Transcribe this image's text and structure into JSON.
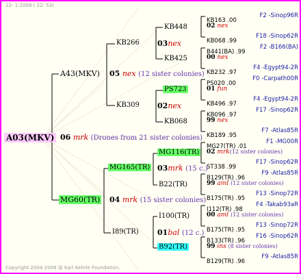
{
  "header": {
    "date_label": "12-  1-2008 ( 22: 53)"
  },
  "footer": {
    "copyright": "Copyright 2004-2008 @ Karl Kehrle Foundation."
  },
  "root": {
    "name": "A03(MKV)"
  },
  "gen1": {
    "father": {
      "name": "A43(MKV)",
      "num": "05",
      "tag": "nex",
      "note": "(12 sister colonies)"
    },
    "mother": {
      "name": "MG60(TR)",
      "num": "04",
      "tag": "mrk",
      "note": "(15 sister colonies)"
    },
    "mid": {
      "num": "06",
      "tag": "mrk",
      "note": "(Drones from 21 sister colonies)"
    }
  },
  "gen2": {
    "kb266": {
      "name": "KB266",
      "num": "03",
      "tag": "nex"
    },
    "kb309": {
      "name": "KB309",
      "num": "02",
      "tag": "nex"
    },
    "mg165": {
      "name": "MG165(TR)",
      "num": "03",
      "tag": "mrk",
      "note": "(15 c.)"
    },
    "i89": {
      "name": "I89(TR)",
      "num": "01",
      "tag": "bal",
      "note": "(12 c.)"
    }
  },
  "gen3": {
    "kb448": {
      "name": "KB448"
    },
    "kb425": {
      "name": "KB425"
    },
    "ps723": {
      "name": "PS723"
    },
    "kb068": {
      "name": "KB068"
    },
    "mg116": {
      "name": "MG116(TR)"
    },
    "b22": {
      "name": "B22(TR)"
    },
    "i100": {
      "name": "I100(TR)"
    },
    "b92": {
      "name": "B92(TR)"
    }
  },
  "gen4": [
    {
      "top": "KB163 .00",
      "topr": "F2 -Sinop96R",
      "num": "02",
      "tag": "nex",
      "note": "",
      "bot": "KB068 .99",
      "botr": "F18 -Sinop62R"
    },
    {
      "top": "B441(BA) .99",
      "topr": "F2 -B166(BA)",
      "num": "00",
      "tag": "nex",
      "note": "",
      "bot": "KB232 .97",
      "botr": "F4 -Egypt94-2R"
    },
    {
      "top": "PS020 .00",
      "topr": "F0 -Carpath00R",
      "num": "01",
      "tag": "fun",
      "note": "",
      "bot": "KB496 .97",
      "botr": "F4 -Egypt94-2R"
    },
    {
      "top": "KB096 .97",
      "topr": "F17 -Sinop62R",
      "num": "99",
      "tag": "nex",
      "note": "",
      "bot": "KB189 .95",
      "botr": "F7 -Atlas85R"
    },
    {
      "top": "MG27(TR) .01",
      "topr": "F1 -MG00R",
      "num": "02",
      "tag": "mrk",
      "note": "(12 sister colonies)",
      "bot": "ST338 .99",
      "botr": "F17 -Sinop62R"
    },
    {
      "top": "B129(TR) .96",
      "topr": "F9 -Atlas85R",
      "num": "99",
      "tag": "aml",
      "note": "(12 sister colonies)",
      "bot": "B175(TR) .95",
      "botr": "F13 -Sinop72R"
    },
    {
      "top": "I112(TR) .98",
      "topr": "F4 -Takab93aR",
      "num": "00",
      "tag": "aml",
      "note": "(12 sister colonies)",
      "bot": "B175(TR) .95",
      "botr": "F13 -Sinop72R"
    },
    {
      "top": "B133(TR) .96",
      "topr": "F16 -Sinop62R",
      "num": "99",
      "tag": "ins",
      "note": "(8 sister colonies)",
      "bot": "B129(TR) .96",
      "botr": "F9 -Atlas85R"
    }
  ]
}
